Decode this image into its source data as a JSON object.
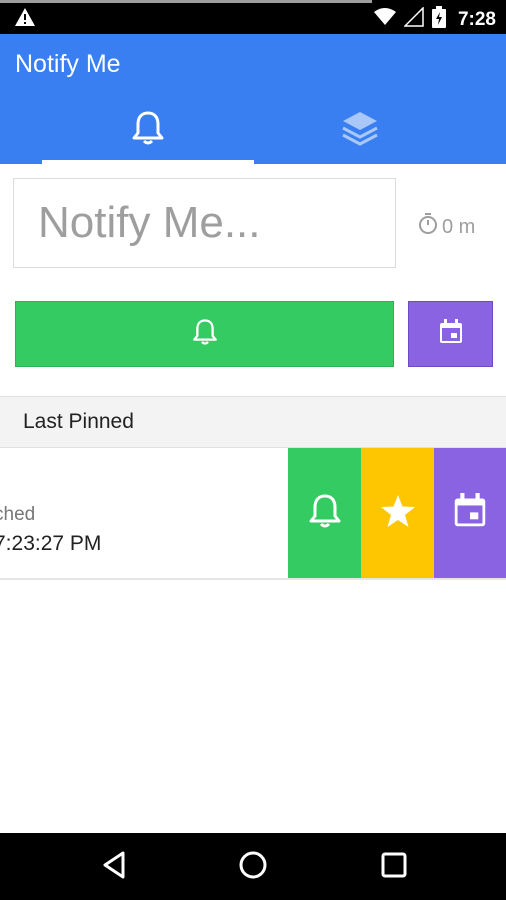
{
  "status_bar": {
    "time": "7:28",
    "icons": [
      "warning-icon",
      "wifi-icon",
      "signal-icon",
      "battery-charging-icon"
    ]
  },
  "app": {
    "title": "Notify Me",
    "accent_color": "#3a7ff1",
    "tabs": [
      {
        "icon": "bell-icon",
        "selected": true
      },
      {
        "icon": "layers-icon",
        "selected": false
      }
    ]
  },
  "input": {
    "placeholder": "Notify Me...",
    "timer_label": "0 m",
    "timer_icon": "stopwatch-icon"
  },
  "actions": {
    "notify_color": "#34cb63",
    "calendar_color": "#8a63e2",
    "notify_icon": "bell-icon",
    "calendar_icon": "calendar-icon"
  },
  "section": {
    "title": "Last Pinned"
  },
  "pinned_item": {
    "subtitle": "ched",
    "time": "7:23:27 PM",
    "swipe_actions": [
      {
        "icon": "bell-icon",
        "color": "#34cb63"
      },
      {
        "icon": "star-icon",
        "color": "#fec600"
      },
      {
        "icon": "calendar-icon",
        "color": "#8a63e2"
      }
    ]
  },
  "nav_bar": {
    "buttons": [
      "back-icon",
      "home-icon",
      "recents-icon"
    ]
  }
}
